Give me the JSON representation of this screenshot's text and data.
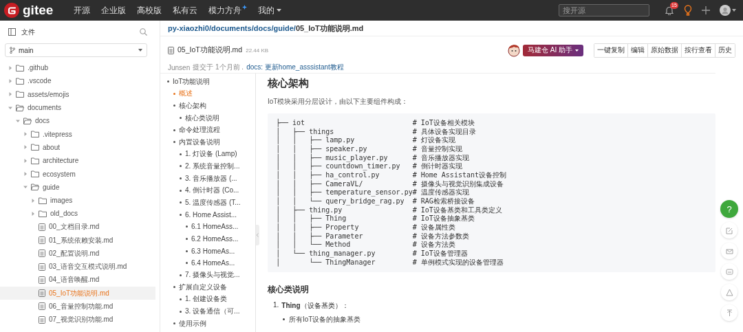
{
  "topbar": {
    "brand": "gitee",
    "nav": [
      {
        "label": "开源",
        "kind": "plain"
      },
      {
        "label": "企业版",
        "kind": "plain"
      },
      {
        "label": "高校版",
        "kind": "plain"
      },
      {
        "label": "私有云",
        "kind": "plain"
      },
      {
        "label": "模力方舟",
        "kind": "sparkle"
      },
      {
        "label": "我的",
        "kind": "menu"
      }
    ],
    "search": {
      "placeholder": "搜开源"
    },
    "notifications": "15"
  },
  "sidebar": {
    "title": "文件",
    "branch": "main",
    "tree": [
      {
        "name": ".github",
        "kind": "folder",
        "expanded": false,
        "selected": false
      },
      {
        "name": ".vscode",
        "kind": "folder",
        "expanded": false,
        "selected": false
      },
      {
        "name": "assets/emojis",
        "kind": "folder",
        "expanded": false,
        "selected": false
      },
      {
        "name": "documents",
        "kind": "folder",
        "expanded": true,
        "selected": false,
        "children": [
          {
            "name": "docs",
            "kind": "folder",
            "expanded": true,
            "selected": false,
            "children": [
              {
                "name": ".vitepress",
                "kind": "folder",
                "expanded": false,
                "selected": false
              },
              {
                "name": "about",
                "kind": "folder",
                "expanded": false,
                "selected": false
              },
              {
                "name": "architecture",
                "kind": "folder",
                "expanded": false,
                "selected": false
              },
              {
                "name": "ecosystem",
                "kind": "folder",
                "expanded": false,
                "selected": false
              },
              {
                "name": "guide",
                "kind": "folder",
                "expanded": true,
                "selected": false,
                "children": [
                  {
                    "name": "images",
                    "kind": "folder",
                    "expanded": false,
                    "selected": false
                  },
                  {
                    "name": "old_docs",
                    "kind": "folder",
                    "expanded": false,
                    "selected": false
                  },
                  {
                    "name": "00_文档目录.md",
                    "kind": "file",
                    "selected": false
                  },
                  {
                    "name": "01_系统依赖安装.md",
                    "kind": "file",
                    "selected": false
                  },
                  {
                    "name": "02_配置说明.md",
                    "kind": "file",
                    "selected": false
                  },
                  {
                    "name": "03_语音交互模式说明.md",
                    "kind": "file",
                    "selected": false
                  },
                  {
                    "name": "04_语音唤醒.md",
                    "kind": "file",
                    "selected": false
                  },
                  {
                    "name": "05_IoT功能说明.md",
                    "kind": "file",
                    "selected": true
                  },
                  {
                    "name": "06_音量控制功能.md",
                    "kind": "file",
                    "selected": false
                  },
                  {
                    "name": "07_视觉识别功能.md",
                    "kind": "file",
                    "selected": false
                  }
                ]
              }
            ]
          }
        ]
      }
    ]
  },
  "breadcrumb": {
    "separator": "/",
    "links": [
      "py-xiaozhi0",
      "documents",
      "docs",
      "guide"
    ],
    "current": "05_IoT功能说明.md"
  },
  "file": {
    "name": "05_IoT功能说明.md",
    "size": "22.44 KB",
    "ai_button": "马建仓 AI 助手",
    "actions": [
      "一键复制",
      "编辑",
      "原始数据",
      "按行查看",
      "历史"
    ],
    "commit": {
      "author": "Junsen",
      "text": "提交于 1个月前 .",
      "message": "docs: 更新home_asssistant教程"
    }
  },
  "toc": [
    {
      "label": "IoT功能说明",
      "selected": false,
      "children": [
        {
          "label": "概述",
          "selected": true
        },
        {
          "label": "核心架构",
          "selected": false,
          "children": [
            {
              "label": "核心类说明",
              "selected": false
            }
          ]
        },
        {
          "label": "命令处理流程",
          "selected": false
        },
        {
          "label": "内置设备说明",
          "selected": false,
          "children": [
            {
              "label": "1. 灯设备 (Lamp)",
              "selected": false
            },
            {
              "label": "2. 系统音量控制...",
              "selected": false
            },
            {
              "label": "3. 音乐播放器 (...",
              "selected": false
            },
            {
              "label": "4. 倒计时器 (Co...",
              "selected": false
            },
            {
              "label": "5. 温度传感器 (T...",
              "selected": false
            },
            {
              "label": "6. Home Assist...",
              "selected": false,
              "children": [
                {
                  "label": "6.1 HomeAss...",
                  "selected": false
                },
                {
                  "label": "6.2 HomeAss...",
                  "selected": false
                },
                {
                  "label": "6.3 HomeAs...",
                  "selected": false
                },
                {
                  "label": "6.4 HomeAs...",
                  "selected": false
                }
              ]
            },
            {
              "label": "7. 摄像头与视觉...",
              "selected": false
            }
          ]
        },
        {
          "label": "扩展自定义设备",
          "selected": false,
          "children": [
            {
              "label": "1. 创建设备类",
              "selected": false
            },
            {
              "label": "3. 设备通信（可...",
              "selected": false
            }
          ]
        },
        {
          "label": "使用示例",
          "selected": false
        }
      ]
    }
  ],
  "content": {
    "heading": "核心架构",
    "intro": "IoT模块采用分层设计，由以下主要组件构成：",
    "code": [
      {
        "path": "├── iot",
        "comment": "# IoT设备相关模块"
      },
      {
        "path": "│   ├── things",
        "comment": "# 具体设备实现目录"
      },
      {
        "path": "│   │   ├── lamp.py",
        "comment": "# 灯设备实现"
      },
      {
        "path": "│   │   ├── speaker.py",
        "comment": "# 音量控制实现"
      },
      {
        "path": "│   │   ├── music_player.py",
        "comment": "# 音乐播放器实现"
      },
      {
        "path": "│   │   ├── countdown_timer.py",
        "comment": "# 倒计时器实现"
      },
      {
        "path": "│   │   ├── ha_control.py",
        "comment": "# Home Assistant设备控制"
      },
      {
        "path": "│   │   ├── CameraVL/",
        "comment": "# 摄像头与视觉识别集成设备"
      },
      {
        "path": "│   │   ├── temperature_sensor.py",
        "comment": "# 温度传感器实现"
      },
      {
        "path": "│   │   └── query_bridge_rag.py",
        "comment": "# RAG检索桥接设备"
      },
      {
        "path": "│   ├── thing.py",
        "comment": "# IoT设备基类和工具类定义"
      },
      {
        "path": "│   │   ├── Thing",
        "comment": "# IoT设备抽象基类"
      },
      {
        "path": "│   │   ├── Property",
        "comment": "# 设备属性类"
      },
      {
        "path": "│   │   ├── Parameter",
        "comment": "# 设备方法参数类"
      },
      {
        "path": "│   │   └── Method",
        "comment": "# 设备方法类"
      },
      {
        "path": "│   └── thing_manager.py",
        "comment": "# IoT设备管理器"
      },
      {
        "path": "│       └── ThingManager",
        "comment": "# 单例模式实现的设备管理器"
      }
    ],
    "subheading": "核心类说明",
    "list": [
      {
        "number": "1.",
        "text": "**Thing**（设备基类）：",
        "bullets": [
          "所有IoT设备的抽象基类"
        ]
      }
    ]
  },
  "float_buttons": [
    {
      "kind": "help",
      "label": "?"
    },
    {
      "kind": "edit"
    },
    {
      "kind": "mail"
    },
    {
      "kind": "chat"
    },
    {
      "kind": "warning"
    },
    {
      "kind": "up"
    }
  ]
}
